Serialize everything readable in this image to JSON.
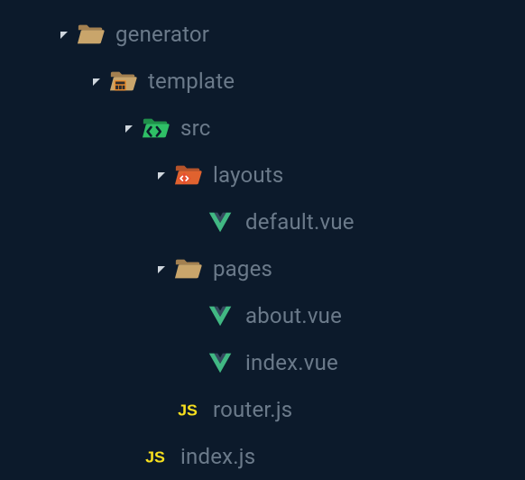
{
  "tree": [
    {
      "id": "generator",
      "label": "generator",
      "depth": 0,
      "expanded": true,
      "icon": "folder-open",
      "kind": "folder"
    },
    {
      "id": "template",
      "label": "template",
      "depth": 1,
      "expanded": true,
      "icon": "folder-template",
      "kind": "folder"
    },
    {
      "id": "src",
      "label": "src",
      "depth": 2,
      "expanded": true,
      "icon": "folder-src",
      "kind": "folder"
    },
    {
      "id": "layouts",
      "label": "layouts",
      "depth": 3,
      "expanded": true,
      "icon": "folder-layouts",
      "kind": "folder"
    },
    {
      "id": "default-vue",
      "label": "default.vue",
      "depth": 4,
      "expanded": null,
      "icon": "vue",
      "kind": "file"
    },
    {
      "id": "pages",
      "label": "pages",
      "depth": 3,
      "expanded": true,
      "icon": "folder-open",
      "kind": "folder"
    },
    {
      "id": "about-vue",
      "label": "about.vue",
      "depth": 4,
      "expanded": null,
      "icon": "vue",
      "kind": "file"
    },
    {
      "id": "index-vue",
      "label": "index.vue",
      "depth": 4,
      "expanded": null,
      "icon": "vue",
      "kind": "file"
    },
    {
      "id": "router-js",
      "label": "router.js",
      "depth": 3,
      "expanded": null,
      "icon": "js",
      "kind": "file"
    },
    {
      "id": "index-js",
      "label": "index.js",
      "depth": 2,
      "expanded": null,
      "icon": "js",
      "kind": "file"
    }
  ],
  "indentPx": 36,
  "baseIndentPx": 52
}
